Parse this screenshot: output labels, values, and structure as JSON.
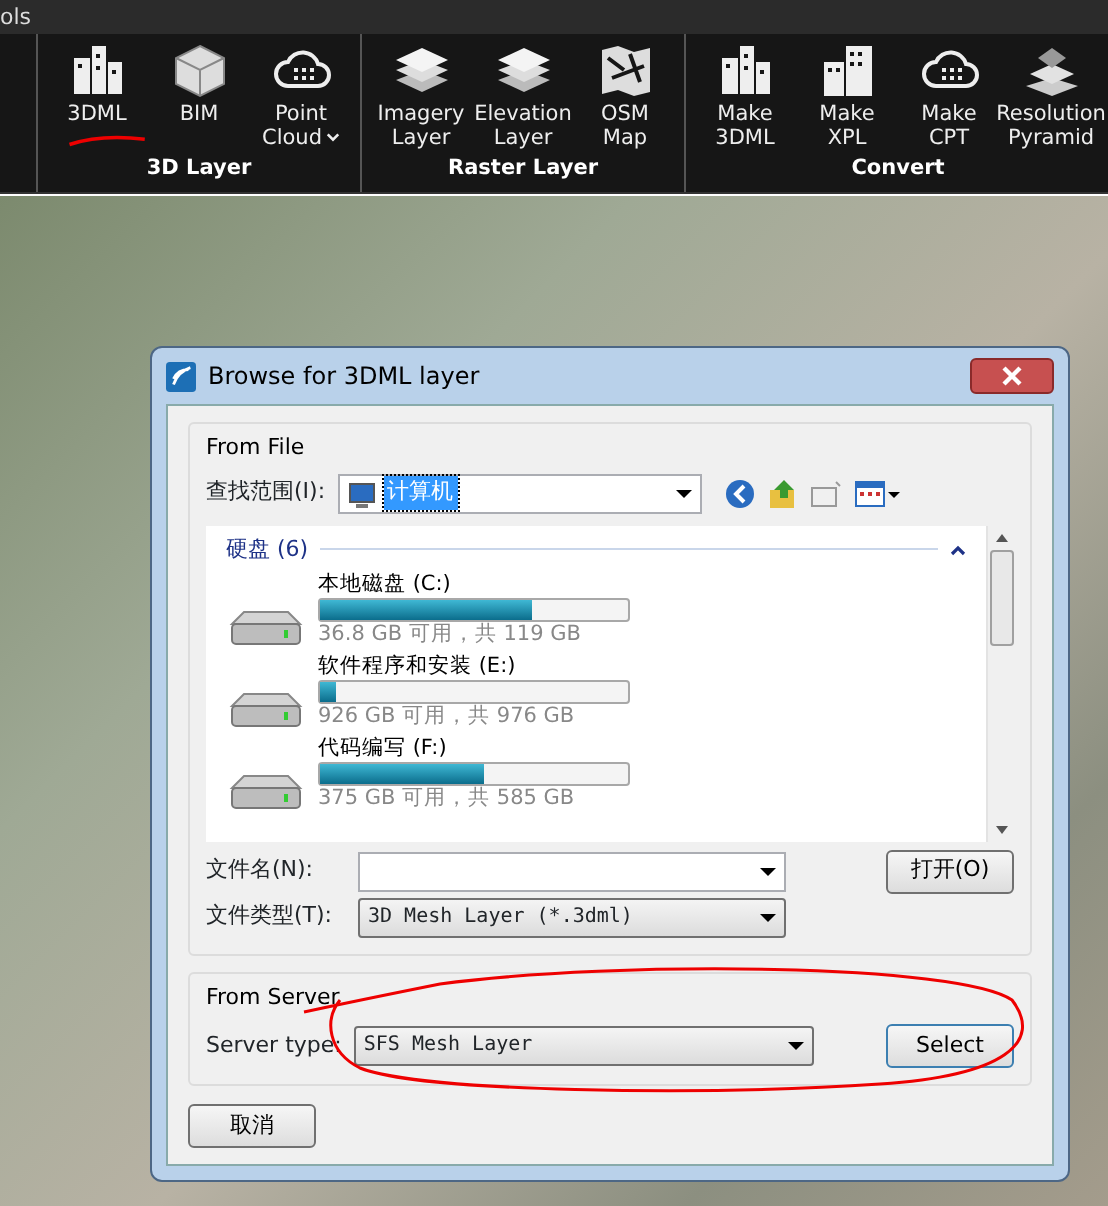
{
  "app_title": "ols",
  "ribbon": {
    "groups": [
      {
        "label": "3D Layer",
        "buttons": [
          {
            "kind": "buildings",
            "lines": [
              "3DML"
            ],
            "has_menu": false
          },
          {
            "kind": "cube",
            "lines": [
              "BIM"
            ],
            "has_menu": false
          },
          {
            "kind": "cloud",
            "lines": [
              "Point",
              "Cloud"
            ],
            "has_menu": true
          }
        ]
      },
      {
        "label": "Raster Layer",
        "buttons": [
          {
            "kind": "layers",
            "lines": [
              "Imagery",
              "Layer"
            ],
            "has_menu": false
          },
          {
            "kind": "layers",
            "lines": [
              "Elevation",
              "Layer"
            ],
            "has_menu": false
          },
          {
            "kind": "map",
            "lines": [
              "OSM",
              "Map"
            ],
            "has_menu": false
          }
        ]
      },
      {
        "label": "Convert",
        "buttons": [
          {
            "kind": "buildings",
            "lines": [
              "Make",
              "3DML"
            ],
            "has_menu": false
          },
          {
            "kind": "tower",
            "lines": [
              "Make",
              "XPL"
            ],
            "has_menu": false
          },
          {
            "kind": "cloud",
            "lines": [
              "Make",
              "CPT"
            ],
            "has_menu": false
          },
          {
            "kind": "pyramid",
            "lines": [
              "Resolution",
              "Pyramid"
            ],
            "has_menu": false
          }
        ]
      }
    ]
  },
  "dialog": {
    "title": "Browse for 3DML layer",
    "from_file": {
      "legend": "From File",
      "look_in_label": "查找范围(I):",
      "look_in_value": "计算机",
      "section": "硬盘 (6)",
      "drives": [
        {
          "name": "本地磁盘 (C:)",
          "level": 0.69,
          "reading": "36.8 GB 可用，共 119 GB"
        },
        {
          "name": "软件程序和安装 (E:)",
          "level": 0.05,
          "reading": "926 GB 可用，共 976 GB"
        },
        {
          "name": "代码编写 (F:)",
          "level": 0.53,
          "reading": "375 GB 可用，共 585 GB"
        }
      ],
      "file_name_label": "文件名(N):",
      "open_button": "打开(O)",
      "file_type_label": "文件类型(T):",
      "file_type_value": "3D Mesh Layer (*.3dml)"
    },
    "from_server": {
      "legend": "From Server",
      "server_type_label": "Server type:",
      "server_type_value": "SFS Mesh Layer",
      "select_button": "Select"
    },
    "cancel_button": "取消"
  }
}
